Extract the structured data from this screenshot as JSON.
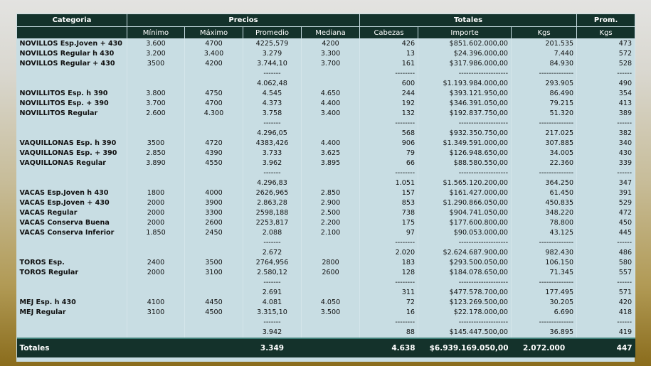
{
  "headers": {
    "categoria": "Categoria",
    "precios": "Precios",
    "totales": "Totales",
    "prom": "Prom.",
    "minimo": "Mínimo",
    "maximo": "Máximo",
    "promedio": "Promedio",
    "mediana": "Mediana",
    "cabezas": "Cabezas",
    "importe": "Importe",
    "kgs": "Kgs",
    "prom_kgs": "Kgs"
  },
  "rows": [
    {
      "cat": "NOVILLOS Esp.Joven + 430",
      "min": "3.600",
      "max": "4700",
      "prom": "4225,579",
      "med": "4200",
      "cab": "426",
      "imp": "$851.602.000,00",
      "kgs": "201.535",
      "pk": "473"
    },
    {
      "cat": "NOVILLOS Regular h 430",
      "min": "3.200",
      "max": "3.400",
      "prom": "3.279",
      "med": "3.300",
      "cab": "13",
      "imp": "$24.396.000,00",
      "kgs": "7.440",
      "pk": "572"
    },
    {
      "cat": "NOVILLOS Regular + 430",
      "min": "3500",
      "max": "4200",
      "prom": "3.744,10",
      "med": "3.700",
      "cab": "161",
      "imp": "$317.986.000,00",
      "kgs": "84.930",
      "pk": "528"
    },
    {
      "cat": "",
      "min": "",
      "max": "",
      "prom": "-------",
      "med": "",
      "cab": "--------",
      "imp": "--------------------",
      "kgs": "--------------",
      "pk": "------"
    },
    {
      "cat": "",
      "min": "",
      "max": "",
      "prom": "4.062,48",
      "med": "",
      "cab": "600",
      "imp": "$1.193.984.000,00",
      "kgs": "293.905",
      "pk": "490"
    },
    {
      "cat": "NOVILLITOS Esp. h 390",
      "min": "3.800",
      "max": "4750",
      "prom": "4.545",
      "med": "4.650",
      "cab": "244",
      "imp": "$393.121.950,00",
      "kgs": "86.490",
      "pk": "354"
    },
    {
      "cat": "NOVILLITOS Esp. + 390",
      "min": "3.700",
      "max": "4700",
      "prom": "4.373",
      "med": "4.400",
      "cab": "192",
      "imp": "$346.391.050,00",
      "kgs": "79.215",
      "pk": "413"
    },
    {
      "cat": "NOVILLITOS Regular",
      "min": "2.600",
      "max": "4.300",
      "prom": "3.758",
      "med": "3.400",
      "cab": "132",
      "imp": "$192.837.750,00",
      "kgs": "51.320",
      "pk": "389"
    },
    {
      "cat": "",
      "min": "",
      "max": "",
      "prom": "-------",
      "med": "",
      "cab": "--------",
      "imp": "--------------------",
      "kgs": "--------------",
      "pk": "------"
    },
    {
      "cat": "",
      "min": "",
      "max": "",
      "prom": "4.296,05",
      "med": "",
      "cab": "568",
      "imp": "$932.350.750,00",
      "kgs": "217.025",
      "pk": "382"
    },
    {
      "cat": "VAQUILLONAS Esp. h 390",
      "min": "3500",
      "max": "4720",
      "prom": "4383,426",
      "med": "4.400",
      "cab": "906",
      "imp": "$1.349.591.000,00",
      "kgs": "307.885",
      "pk": "340"
    },
    {
      "cat": "VAQUILLONAS Esp. + 390",
      "min": "2.850",
      "max": "4390",
      "prom": "3.733",
      "med": "3.625",
      "cab": "79",
      "imp": "$126.948.650,00",
      "kgs": "34.005",
      "pk": "430"
    },
    {
      "cat": "VAQUILLONAS Regular",
      "min": "3.890",
      "max": "4550",
      "prom": "3.962",
      "med": "3.895",
      "cab": "66",
      "imp": "$88.580.550,00",
      "kgs": "22.360",
      "pk": "339"
    },
    {
      "cat": "",
      "min": "",
      "max": "",
      "prom": "-------",
      "med": "",
      "cab": "--------",
      "imp": "--------------------",
      "kgs": "--------------",
      "pk": "------"
    },
    {
      "cat": "",
      "min": "",
      "max": "",
      "prom": "4.296,83",
      "med": "",
      "cab": "1.051",
      "imp": "$1.565.120.200,00",
      "kgs": "364.250",
      "pk": "347"
    },
    {
      "cat": "VACAS Esp.Joven h 430",
      "min": "1800",
      "max": "4000",
      "prom": "2626,965",
      "med": "2.850",
      "cab": "157",
      "imp": "$161.427.000,00",
      "kgs": "61.450",
      "pk": "391"
    },
    {
      "cat": "VACAS Esp.Joven + 430",
      "min": "2000",
      "max": "3900",
      "prom": "2.863,28",
      "med": "2.900",
      "cab": "853",
      "imp": "$1.290.866.050,00",
      "kgs": "450.835",
      "pk": "529"
    },
    {
      "cat": "VACAS Regular",
      "min": "2000",
      "max": "3300",
      "prom": "2598,188",
      "med": "2.500",
      "cab": "738",
      "imp": "$904.741.050,00",
      "kgs": "348.220",
      "pk": "472"
    },
    {
      "cat": "VACAS Conserva Buena",
      "min": "2000",
      "max": "2600",
      "prom": "2253,817",
      "med": "2.200",
      "cab": "175",
      "imp": "$177.600.800,00",
      "kgs": "78.800",
      "pk": "450"
    },
    {
      "cat": "VACAS Conserva Inferior",
      "min": "1.850",
      "max": "2450",
      "prom": "2.088",
      "med": "2.100",
      "cab": "97",
      "imp": "$90.053.000,00",
      "kgs": "43.125",
      "pk": "445"
    },
    {
      "cat": "",
      "min": "",
      "max": "",
      "prom": "-------",
      "med": "",
      "cab": "--------",
      "imp": "--------------------",
      "kgs": "--------------",
      "pk": "------"
    },
    {
      "cat": "",
      "min": "",
      "max": "",
      "prom": "2.672",
      "med": "",
      "cab": "2.020",
      "imp": "$2.624.687.900,00",
      "kgs": "982.430",
      "pk": "486"
    },
    {
      "cat": "TOROS Esp.",
      "min": "2400",
      "max": "3500",
      "prom": "2764,956",
      "med": "2800",
      "cab": "183",
      "imp": "$293.500.050,00",
      "kgs": "106.150",
      "pk": "580"
    },
    {
      "cat": "TOROS Regular",
      "min": "2000",
      "max": "3100",
      "prom": "2.580,12",
      "med": "2600",
      "cab": "128",
      "imp": "$184.078.650,00",
      "kgs": "71.345",
      "pk": "557"
    },
    {
      "cat": "",
      "min": "",
      "max": "",
      "prom": "-------",
      "med": "",
      "cab": "--------",
      "imp": "--------------------",
      "kgs": "--------------",
      "pk": "------"
    },
    {
      "cat": "",
      "min": "",
      "max": "",
      "prom": "2.691",
      "med": "",
      "cab": "311",
      "imp": "$477.578.700,00",
      "kgs": "177.495",
      "pk": "571"
    },
    {
      "cat": "MEJ Esp. h 430",
      "min": "4100",
      "max": "4450",
      "prom": "4.081",
      "med": "4.050",
      "cab": "72",
      "imp": "$123.269.500,00",
      "kgs": "30.205",
      "pk": "420"
    },
    {
      "cat": "MEJ Regular",
      "min": "3100",
      "max": "4500",
      "prom": "3.315,10",
      "med": "3.500",
      "cab": "16",
      "imp": "$22.178.000,00",
      "kgs": "6.690",
      "pk": "418"
    },
    {
      "cat": "",
      "min": "",
      "max": "",
      "prom": "-------",
      "med": "",
      "cab": "--------",
      "imp": "--------------------",
      "kgs": "--------------",
      "pk": "------"
    },
    {
      "cat": "",
      "min": "",
      "max": "",
      "prom": "3.942",
      "med": "",
      "cab": "88",
      "imp": "$145.447.500,00",
      "kgs": "36.895",
      "pk": "419"
    }
  ],
  "totals": {
    "label": "Totales",
    "promedio": "3.349",
    "cabezas": "4.638",
    "importe": "$6.939.169.050,00",
    "kgs": "2.072.000",
    "prom_kgs": "447"
  }
}
